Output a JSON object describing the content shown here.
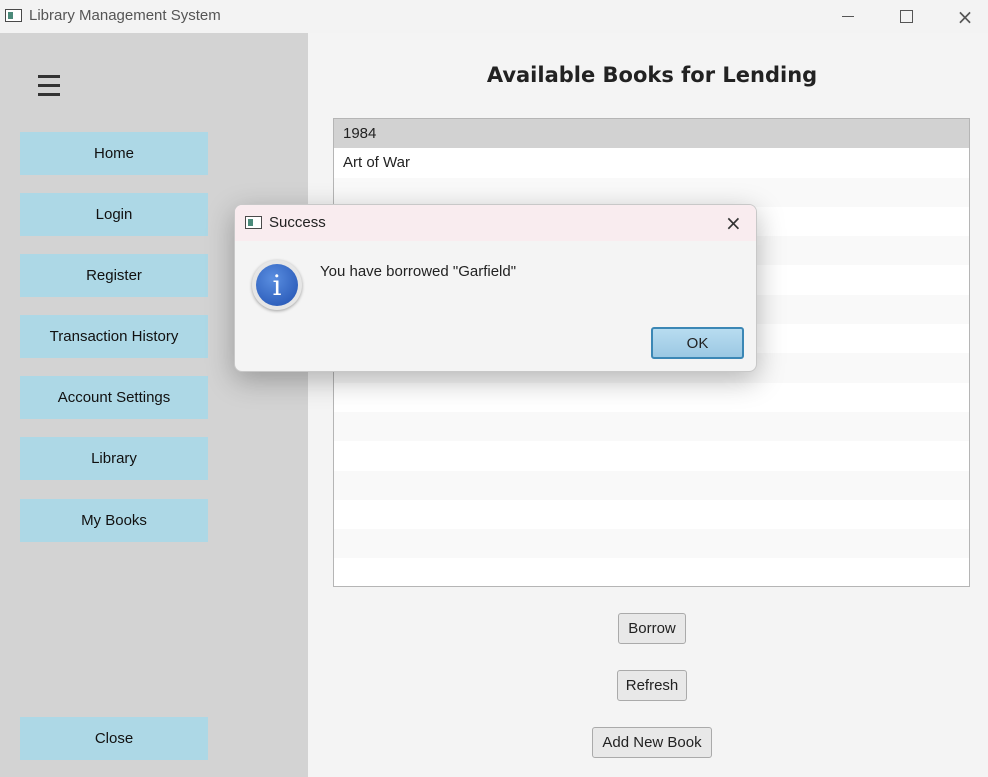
{
  "window": {
    "title": "Library Management System",
    "close_icon": "×"
  },
  "sidebar": {
    "menu_icon": "hamburger-icon",
    "buttons": {
      "home": "Home",
      "login": "Login",
      "register": "Register",
      "transaction_history": "Transaction History",
      "account_settings": "Account Settings",
      "library": "Library",
      "my_books": "My Books",
      "close": "Close"
    }
  },
  "main": {
    "heading": "Available Books for Lending",
    "books": [
      "1984",
      "Art of War"
    ],
    "actions": {
      "borrow": "Borrow",
      "refresh": "Refresh",
      "add_new_book": "Add New Book"
    }
  },
  "dialog": {
    "title": "Success",
    "close_icon": "×",
    "icon": "info-icon",
    "icon_glyph": "i",
    "message": "You have borrowed \"Garfield\"",
    "ok_label": "OK"
  },
  "colors": {
    "sidebar_bg": "#d3d3d3",
    "nav_button_bg": "#add8e6",
    "selected_row": "#d2d2d2",
    "ok_button_border": "#3b87b5"
  }
}
